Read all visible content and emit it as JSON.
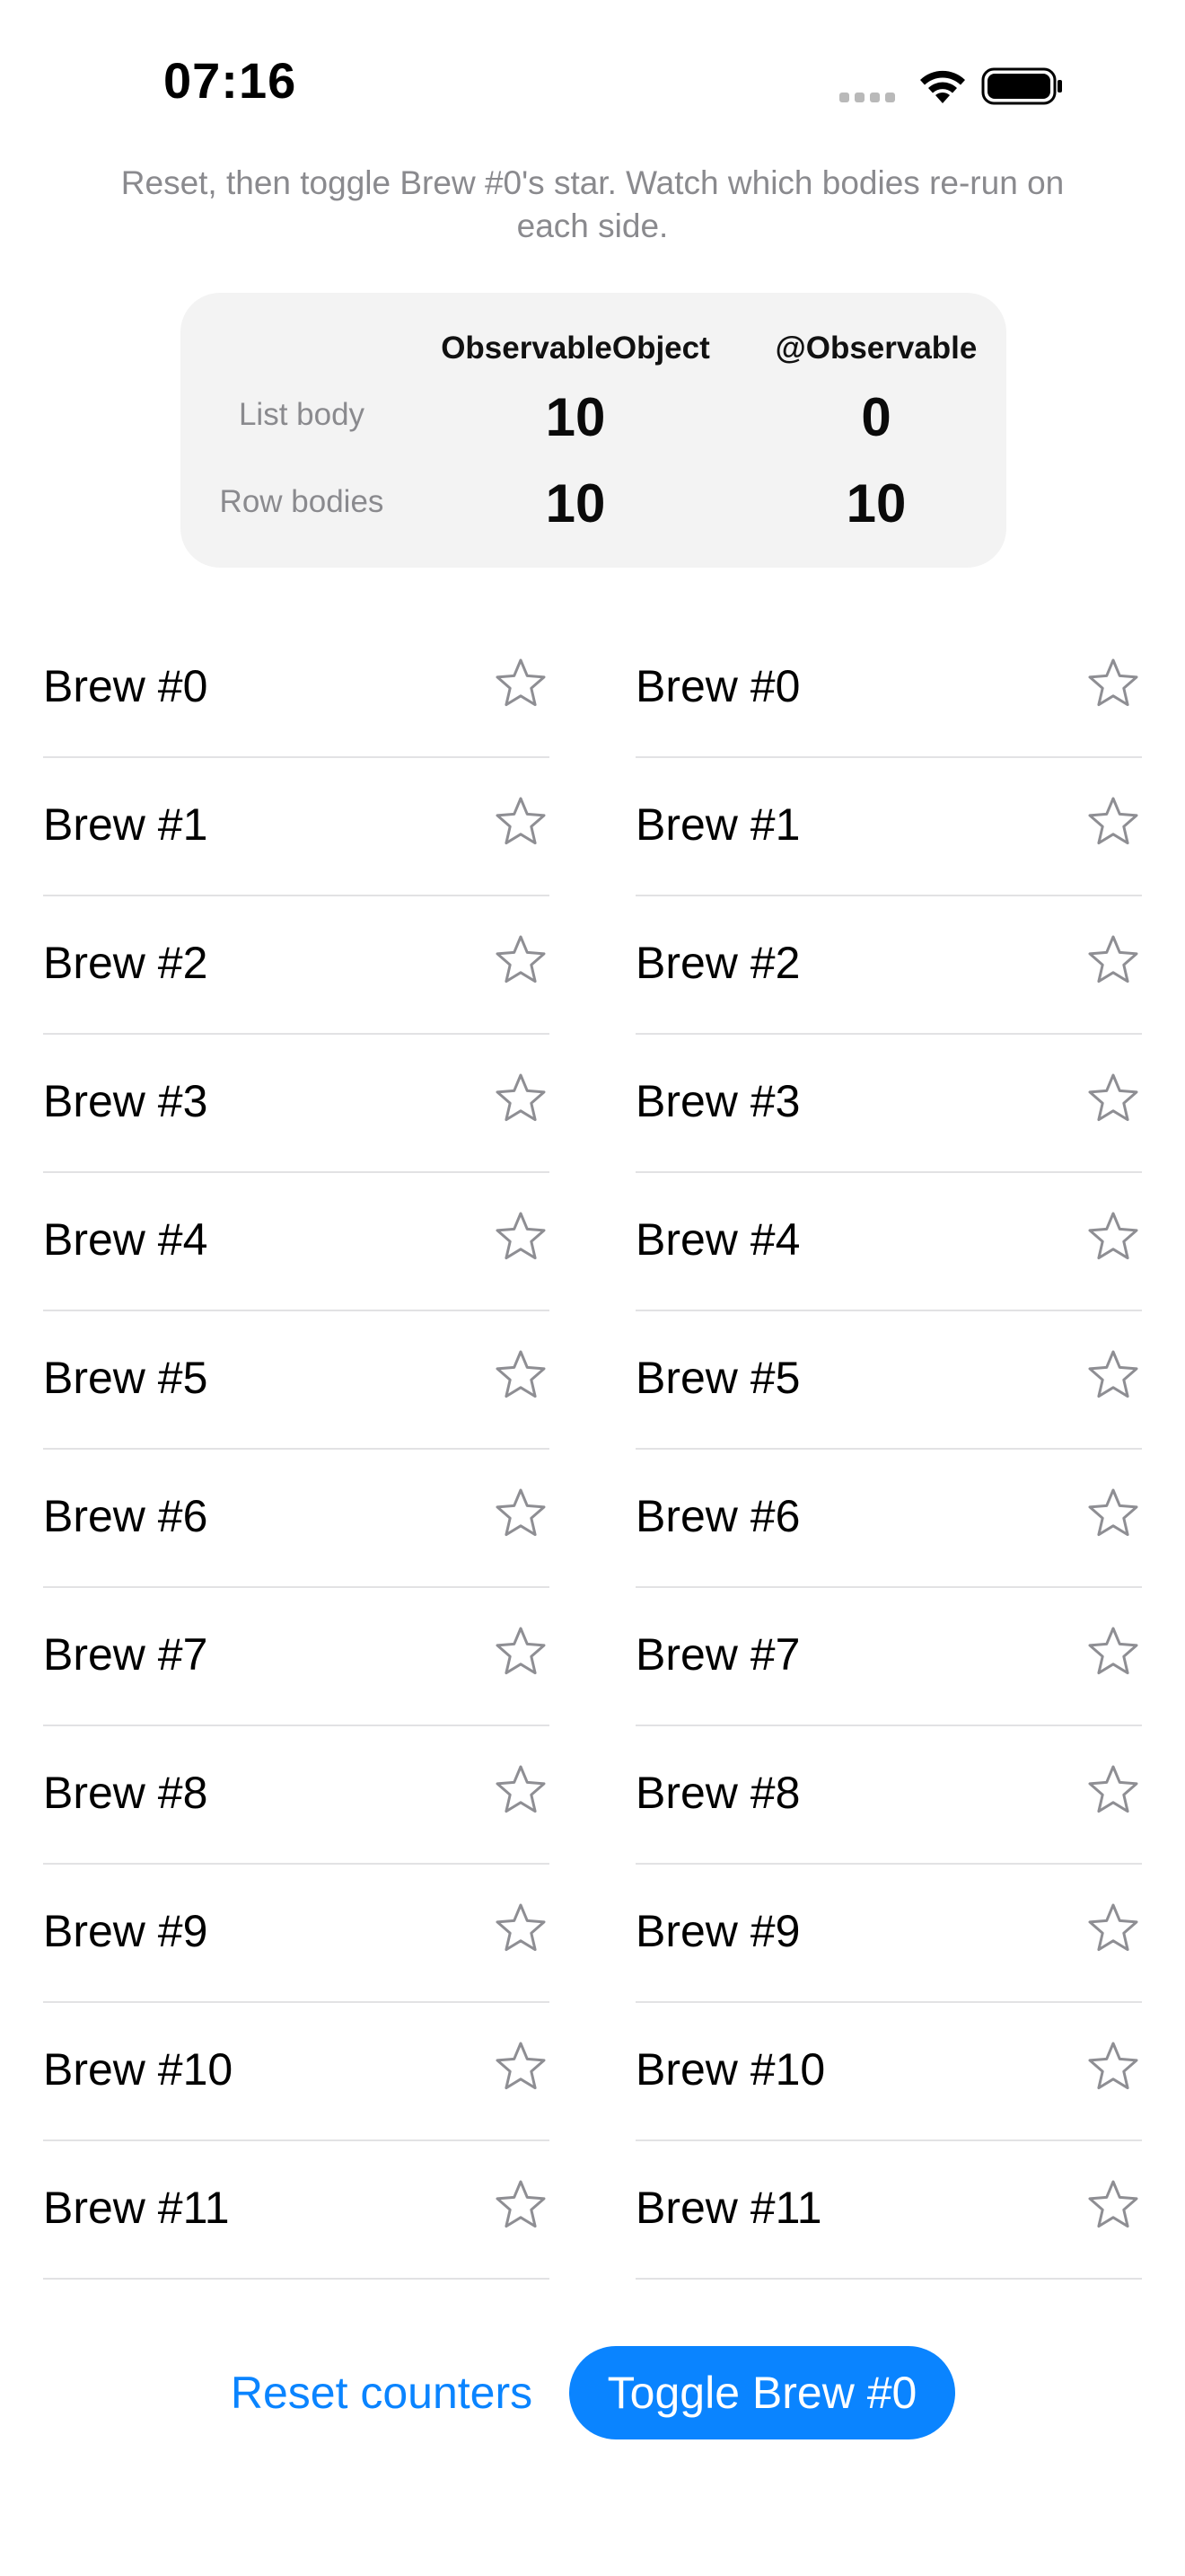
{
  "status_bar": {
    "time": "07:16"
  },
  "instructions": "Reset, then toggle Brew #0's star. Watch which bodies re-run on each side.",
  "counters": {
    "columns": [
      "ObservableObject",
      "@Observable"
    ],
    "rows": [
      {
        "label": "List body",
        "observable_object": "10",
        "observable_macro": "0"
      },
      {
        "label": "Row bodies",
        "observable_object": "10",
        "observable_macro": "10"
      }
    ]
  },
  "lists": {
    "left": [
      {
        "label": "Brew #0",
        "starred": false
      },
      {
        "label": "Brew #1",
        "starred": false
      },
      {
        "label": "Brew #2",
        "starred": false
      },
      {
        "label": "Brew #3",
        "starred": false
      },
      {
        "label": "Brew #4",
        "starred": false
      },
      {
        "label": "Brew #5",
        "starred": false
      },
      {
        "label": "Brew #6",
        "starred": false
      },
      {
        "label": "Brew #7",
        "starred": false
      },
      {
        "label": "Brew #8",
        "starred": false
      },
      {
        "label": "Brew #9",
        "starred": false
      },
      {
        "label": "Brew #10",
        "starred": false
      },
      {
        "label": "Brew #11",
        "starred": false
      }
    ],
    "right": [
      {
        "label": "Brew #0",
        "starred": false
      },
      {
        "label": "Brew #1",
        "starred": false
      },
      {
        "label": "Brew #2",
        "starred": false
      },
      {
        "label": "Brew #3",
        "starred": false
      },
      {
        "label": "Brew #4",
        "starred": false
      },
      {
        "label": "Brew #5",
        "starred": false
      },
      {
        "label": "Brew #6",
        "starred": false
      },
      {
        "label": "Brew #7",
        "starred": false
      },
      {
        "label": "Brew #8",
        "starred": false
      },
      {
        "label": "Brew #9",
        "starred": false
      },
      {
        "label": "Brew #10",
        "starred": false
      },
      {
        "label": "Brew #11",
        "starred": false
      }
    ]
  },
  "buttons": {
    "reset_label": "Reset counters",
    "toggle_label": "Toggle Brew #0"
  },
  "icons": {
    "star": "star-outline-icon",
    "wifi": "wifi-icon",
    "battery": "battery-icon",
    "signal": "cellular-signal-icon"
  },
  "colors": {
    "accent": "#0a84ff",
    "secondary_text": "#8a8a8e",
    "card_background": "#f3f3f3",
    "star_outline": "#8e8e93"
  }
}
